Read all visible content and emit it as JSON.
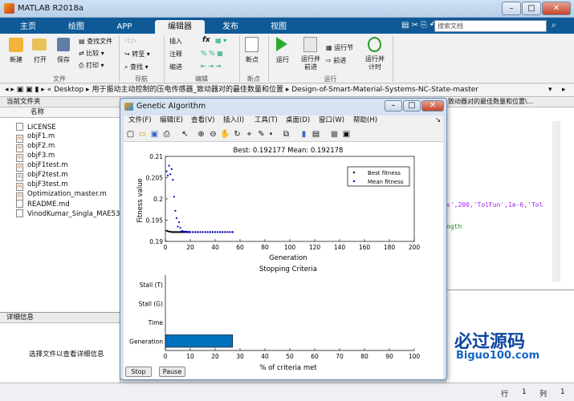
{
  "window": {
    "title": "MATLAB R2018a",
    "min": "–",
    "max": "□",
    "close": "✕"
  },
  "tabs": [
    {
      "label": "主页"
    },
    {
      "label": "绘图"
    },
    {
      "label": "APP"
    },
    {
      "label": "编辑器"
    },
    {
      "label": "发布"
    },
    {
      "label": "视图"
    }
  ],
  "search": {
    "placeholder": "搜索文档"
  },
  "toolstrip": {
    "file": {
      "new": "新建",
      "open": "打开",
      "save": "保存",
      "find_files": "查找文件",
      "compare": "比较",
      "print": "打印",
      "group": "文件"
    },
    "nav": {
      "goto": "转至",
      "find": "查找",
      "group": "导航"
    },
    "edit": {
      "insert": "插入",
      "comment": "注释",
      "indent": "缩进",
      "fx": "fx",
      "group": "编辑"
    },
    "breakpoints": {
      "label": "断点",
      "group": "断点"
    },
    "run": {
      "run": "运行",
      "run_advance": "运行并\n前进",
      "run_section": "运行节",
      "advance": "前进",
      "run_time": "运行并\n计时",
      "group": "运行"
    }
  },
  "address": {
    "path": [
      "Desktop",
      "用于振动主动控制的压电传感器_致动器对的最佳数量和位置",
      "Design-of-Smart-Material-Systems-NC-State-master"
    ]
  },
  "current_folder": {
    "title": "当前文件夹",
    "name_col": "名称",
    "files": [
      "LICENSE",
      "objF1.m",
      "objF2.m",
      "objF3.m",
      "objF1test.m",
      "objF2test.m",
      "objF3test.m",
      "Optimization_master.m",
      "README.md",
      "VinodKumar_Singla_MAE53"
    ]
  },
  "details": {
    "title": "详细信息",
    "hint": "选择文件以查看详细信息"
  },
  "editor": {
    "tab_text": "致动器对的最佳数量和位置\\...",
    "code1": "s',200,'TolFun',1e-6,'Tol",
    "code2": "ngth"
  },
  "status": {
    "row_label": "行",
    "row": "1",
    "col_label": "列",
    "col": "1"
  },
  "watermark": {
    "cn": "必过源码",
    "en": "Biguo100.com"
  },
  "ga": {
    "title": "Genetic Algorithm",
    "menu": [
      "文件(F)",
      "编辑(E)",
      "查看(V)",
      "插入(I)",
      "工具(T)",
      "桌面(D)",
      "窗口(W)",
      "帮助(H)"
    ],
    "stop": "Stop",
    "pause": "Pause"
  },
  "chart_data": [
    {
      "type": "scatter",
      "title": "Best: 0.192177 Mean: 0.192178",
      "xlabel": "Generation",
      "ylabel": "Fitness value",
      "xlim": [
        0,
        200
      ],
      "ylim": [
        0.19,
        0.21
      ],
      "xticks": [
        0,
        20,
        40,
        60,
        80,
        100,
        120,
        140,
        160,
        180,
        200
      ],
      "yticks": [
        0.19,
        0.195,
        0.2,
        0.205,
        0.21
      ],
      "legend": {
        "position": "top-right",
        "entries": [
          "Best fitness",
          "Mean fitness"
        ]
      },
      "series": [
        {
          "name": "Best fitness",
          "color": "#000000",
          "x": [
            1,
            2,
            3,
            4,
            5,
            6,
            7,
            8,
            9,
            10,
            11,
            12,
            13,
            14,
            15,
            16,
            17,
            18,
            19,
            20,
            22,
            24,
            26,
            28,
            30,
            32,
            34,
            36,
            38,
            40,
            42,
            44,
            46,
            48,
            50,
            52,
            54
          ],
          "y": [
            0.1925,
            0.1924,
            0.1923,
            0.1923,
            0.1922,
            0.1922,
            0.1922,
            0.1922,
            0.1922,
            0.1922,
            0.1922,
            0.1922,
            0.1922,
            0.1922,
            0.1922,
            0.1922,
            0.1922,
            0.1922,
            0.1922,
            0.1922,
            0.1922,
            0.1922,
            0.1922,
            0.1922,
            0.1922,
            0.1922,
            0.1922,
            0.1922,
            0.1922,
            0.1922,
            0.1922,
            0.1922,
            0.1922,
            0.1922,
            0.1922,
            0.1922,
            0.1922
          ]
        },
        {
          "name": "Mean fitness",
          "color": "#0000cc",
          "x": [
            1,
            2,
            3,
            4,
            5,
            6,
            7,
            8,
            9,
            10,
            11,
            12,
            13,
            14,
            15,
            16,
            17,
            18,
            19,
            20,
            22,
            24,
            26,
            28,
            30,
            32,
            34,
            36,
            38,
            40,
            42,
            44,
            46,
            48,
            50,
            52,
            54
          ],
          "y": [
            0.2065,
            0.2055,
            0.2078,
            0.2058,
            0.207,
            0.2045,
            0.2005,
            0.1972,
            0.1955,
            0.1935,
            0.1945,
            0.1932,
            0.1924,
            0.1924,
            0.1923,
            0.1923,
            0.1923,
            0.1922,
            0.1922,
            0.1922,
            0.1922,
            0.1922,
            0.1922,
            0.1922,
            0.1922,
            0.1922,
            0.1922,
            0.1922,
            0.1922,
            0.1922,
            0.1922,
            0.1922,
            0.1922,
            0.1922,
            0.1922,
            0.1922,
            0.1922
          ]
        }
      ]
    },
    {
      "type": "bar",
      "orientation": "horizontal",
      "title": "Stopping Criteria",
      "xlabel": "% of criteria met",
      "xlim": [
        0,
        100
      ],
      "xticks": [
        0,
        10,
        20,
        30,
        40,
        50,
        60,
        70,
        80,
        90,
        100
      ],
      "categories": [
        "Stall (T)",
        "Stall (G)",
        "Time",
        "Generation"
      ],
      "values": [
        0,
        0,
        0,
        27
      ],
      "color": "#0072bd"
    }
  ]
}
